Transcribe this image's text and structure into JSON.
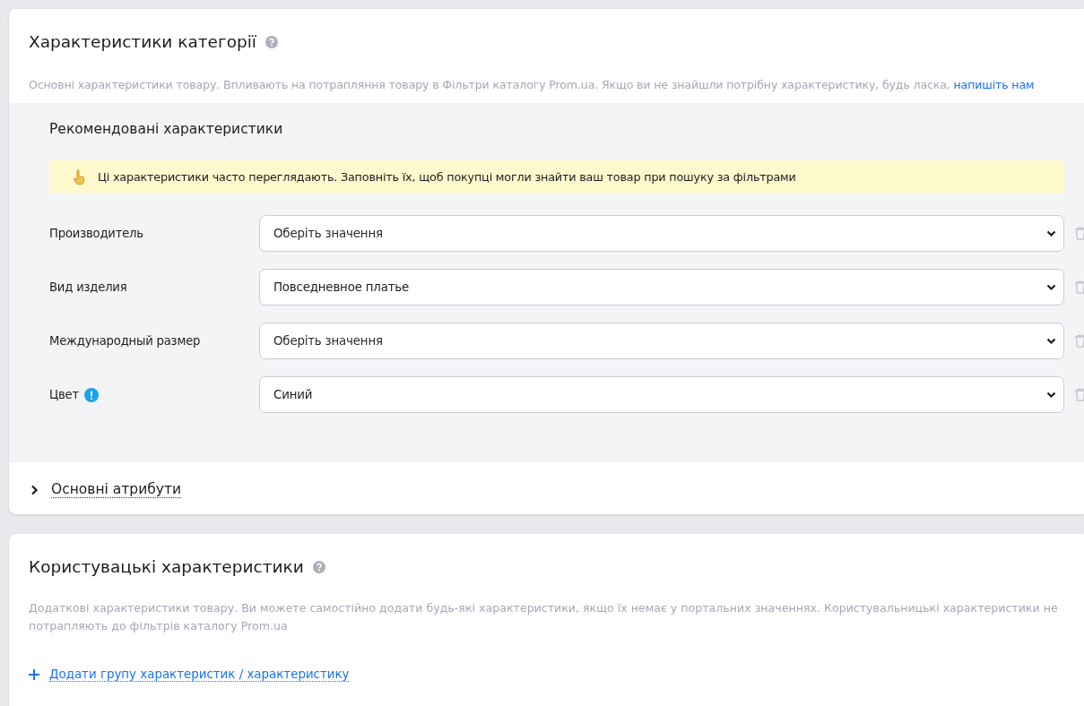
{
  "category_card": {
    "title": "Характеристики категорії",
    "description": "Основні характеристики товару. Впливають на потрапляння товару в Фільтри каталогу Prom.ua. Якщо ви не знайшли потрібну характеристику, будь ласка,",
    "description_link": "напишіть нам",
    "recommended": {
      "title": "Рекомендовані характеристики",
      "notice": "Ці характеристики часто переглядають. Заповніть їх, щоб покупці могли знайти ваш товар при пошуку за фільтрами",
      "fields": [
        {
          "label": "Производитель",
          "value": "Оберіть значення",
          "placeholder_shown": true,
          "alert": false
        },
        {
          "label": "Вид изделия",
          "value": "Повседневное платье",
          "placeholder_shown": false,
          "alert": false
        },
        {
          "label": "Международный размер",
          "value": "Оберіть значення",
          "placeholder_shown": true,
          "alert": false
        },
        {
          "label": "Цвет",
          "value": "Синий",
          "placeholder_shown": false,
          "alert": true
        }
      ]
    },
    "attributes": {
      "label": "Основні атрибути",
      "expanded": false
    }
  },
  "custom_card": {
    "title": "Користувацькі характеристики",
    "description": "Додаткові характеристики товару. Ви можете самостійно додати будь-які характеристики, якщо їх немає у портальних значеннях. Користувальницькі характеристики не потрапляють до фільтрів каталогу Prom.ua",
    "add_link": "Додати групу характеристик / характеристику"
  }
}
